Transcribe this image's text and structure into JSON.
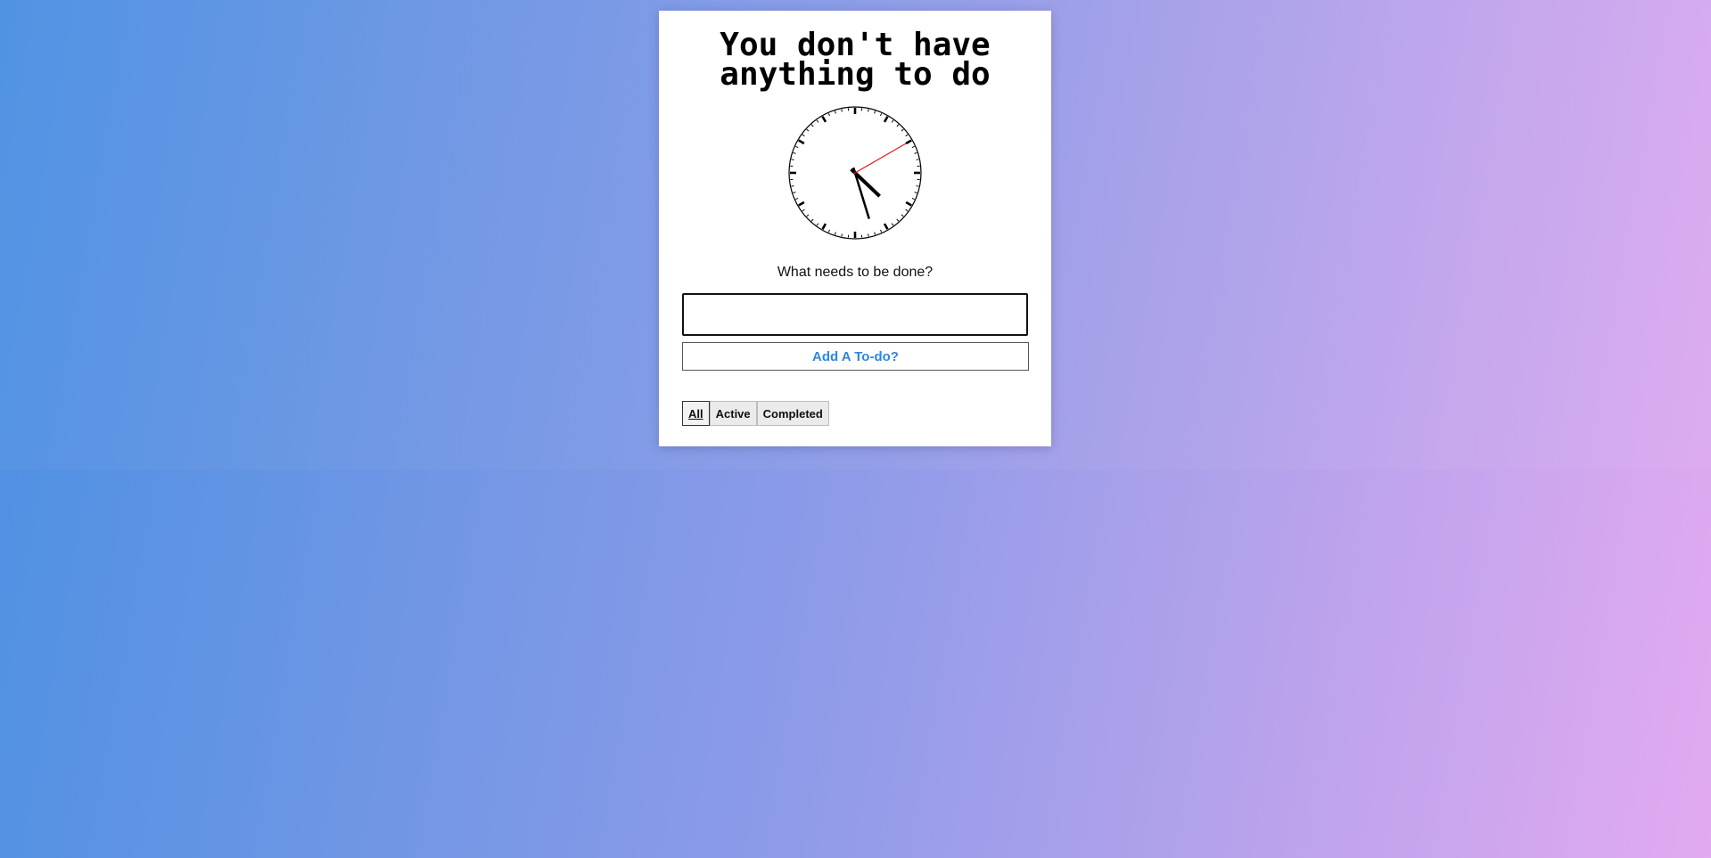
{
  "card": {
    "title": "You don't have\nanything to do"
  },
  "clock": {
    "hour": 4,
    "minute": 27,
    "second": 10
  },
  "todo": {
    "prompt": "What needs to be done?",
    "input_value": "",
    "input_placeholder": "",
    "add_label": "Add A To-do?"
  },
  "filters": {
    "items": [
      {
        "label": "All",
        "selected": true
      },
      {
        "label": "Active",
        "selected": false
      },
      {
        "label": "Completed",
        "selected": false
      }
    ]
  },
  "colors": {
    "accent": "#2f86df",
    "second_hand": "#e01818",
    "gradient_start": "#4a90e2",
    "gradient_end": "#e2aaf0"
  }
}
